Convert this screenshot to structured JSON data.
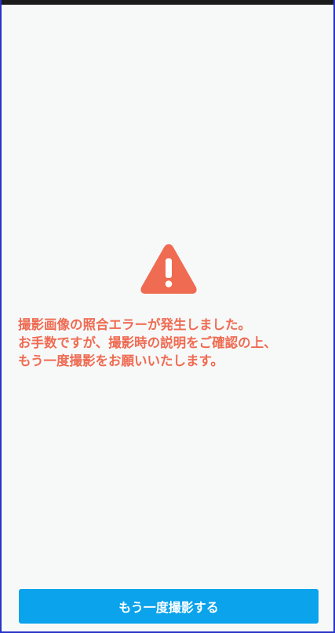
{
  "colors": {
    "accent": "#0aa3ec",
    "error": "#ef6b52",
    "background": "#f7f9f9"
  },
  "alert": {
    "icon": "warning-icon",
    "lines": [
      "撮影画像の照合エラーが発生しました。",
      "お手数ですが、撮影時の説明をご確認の上、",
      "もう一度撮影をお願いいたします。"
    ]
  },
  "actions": {
    "retake_label": "もう一度撮影する"
  }
}
